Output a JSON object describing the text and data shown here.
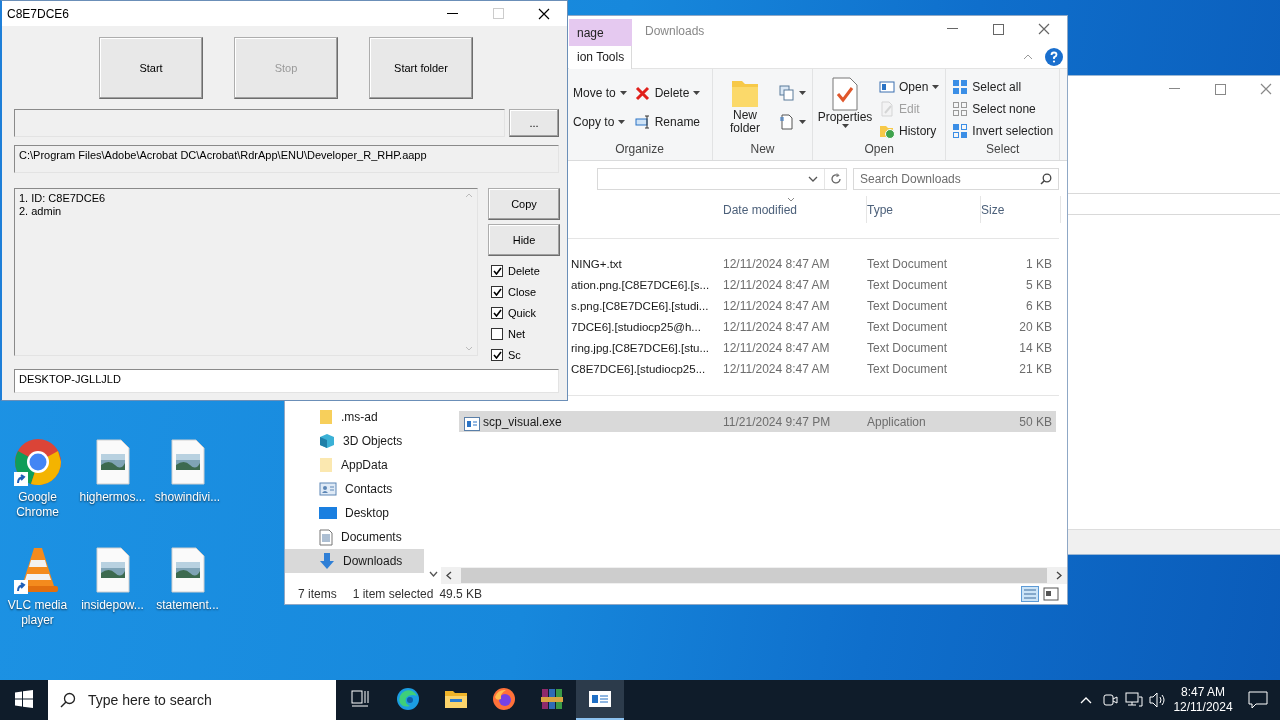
{
  "desktop_icons": [
    {
      "label": "Google Chrome",
      "kind": "chrome"
    },
    {
      "label": "highermos...",
      "kind": "image"
    },
    {
      "label": "showindivi...",
      "kind": "image"
    },
    {
      "label": "VLC media player",
      "kind": "vlc"
    },
    {
      "label": "insidepow...",
      "kind": "image"
    },
    {
      "label": "statement...",
      "kind": "image"
    }
  ],
  "explorer": {
    "context_tab": "nage",
    "context_subtab": "ion Tools",
    "title": "Downloads",
    "ribbon_groups": [
      {
        "label": "Organize",
        "columns": [
          [
            {
              "label": "Move to",
              "kind": "move",
              "dropdown": true,
              "disabled": false
            },
            {
              "label": "Copy to",
              "kind": "copy",
              "dropdown": true,
              "disabled": false
            }
          ],
          [
            {
              "label": "Delete",
              "kind": "delete",
              "dropdown": true,
              "disabled": false
            },
            {
              "label": "Rename",
              "kind": "rename",
              "dropdown": false,
              "disabled": false
            }
          ]
        ]
      },
      {
        "label": "New",
        "columns": [
          [
            {
              "label": "New folder",
              "kind": "new-folder",
              "dropdown": false,
              "disabled": false
            }
          ],
          [
            {
              "kind": "new-item",
              "dropdown": true,
              "disabled": false
            },
            {
              "kind": "easy-access",
              "dropdown": true,
              "disabled": false
            }
          ]
        ]
      },
      {
        "label": "Open",
        "columns": [
          [
            {
              "label": "Properties",
              "kind": "properties",
              "dropdown": true,
              "disabled": false
            }
          ],
          [
            {
              "label": "Open",
              "kind": "open",
              "dropdown": true,
              "disabled": false
            },
            {
              "label": "Edit",
              "kind": "edit",
              "dropdown": false,
              "disabled": true
            },
            {
              "label": "History",
              "kind": "history",
              "dropdown": false,
              "disabled": false
            }
          ]
        ]
      },
      {
        "label": "Select",
        "columns": [
          [
            {
              "label": "Select all",
              "kind": "select-all",
              "dropdown": false,
              "disabled": false
            },
            {
              "label": "Select none",
              "kind": "select-none",
              "dropdown": false,
              "disabled": false
            },
            {
              "label": "Invert selection",
              "kind": "invert",
              "dropdown": false,
              "disabled": false
            }
          ]
        ]
      }
    ],
    "search": {
      "placeholder": "Search Downloads"
    },
    "columns": [
      "Date modified",
      "Type",
      "Size"
    ],
    "today_rows": [
      {
        "name": "NING+.txt",
        "date": "12/11/2024 8:47 AM",
        "type": "Text Document",
        "size": "1 KB",
        "selected": false
      },
      {
        "name": "ation.png.[C8E7DCE6].[s...",
        "date": "12/11/2024 8:47 AM",
        "type": "Text Document",
        "size": "5 KB",
        "selected": false
      },
      {
        "name": "s.png.[C8E7DCE6].[studi...",
        "date": "12/11/2024 8:47 AM",
        "type": "Text Document",
        "size": "6 KB",
        "selected": false
      },
      {
        "name": "7DCE6].[studiocp25@h...",
        "date": "12/11/2024 8:47 AM",
        "type": "Text Document",
        "size": "20 KB",
        "selected": false
      },
      {
        "name": "ring.jpg.[C8E7DCE6].[stu...",
        "date": "12/11/2024 8:47 AM",
        "type": "Text Document",
        "size": "14 KB",
        "selected": false
      },
      {
        "name": "C8E7DCE6].[studiocp25...",
        "date": "12/11/2024 8:47 AM",
        "type": "Text Document",
        "size": "21 KB",
        "selected": false
      }
    ],
    "last_month_rows": [
      {
        "name": "scp_visual.exe",
        "date": "11/21/2024 9:47 PM",
        "type": "Application",
        "size": "50 KB",
        "selected": true
      }
    ],
    "nav": [
      {
        "label": ".ms-ad",
        "kind": "folder",
        "selected": false
      },
      {
        "label": "3D Objects",
        "kind": "cube",
        "selected": false
      },
      {
        "label": "AppData",
        "kind": "folder-light",
        "selected": false
      },
      {
        "label": "Contacts",
        "kind": "contacts",
        "selected": false
      },
      {
        "label": "Desktop",
        "kind": "desktop",
        "selected": false
      },
      {
        "label": "Documents",
        "kind": "documents",
        "selected": false
      },
      {
        "label": "Downloads",
        "kind": "downloads",
        "selected": true
      }
    ],
    "status": {
      "count": "7 items",
      "selection": "1 item selected",
      "size": "49.5 KB"
    }
  },
  "app_window": {
    "title": "C8E7DCE6",
    "buttons": [
      {
        "label": "Start",
        "disabled": false
      },
      {
        "label": "Stop",
        "disabled": true
      },
      {
        "label": "Start folder",
        "disabled": false
      }
    ],
    "browse_button": "...",
    "path": "C:\\Program Files\\Adobe\\Acrobat DC\\Acrobat\\RdrApp\\ENU\\Developer_R_RHP.aapp",
    "log_lines": [
      "1. ID: C8E7DCE6",
      "2. admin"
    ],
    "side_buttons": [
      "Copy",
      "Hide"
    ],
    "options": [
      {
        "label": "Delete",
        "checked": true
      },
      {
        "label": "Close",
        "checked": true
      },
      {
        "label": "Quick",
        "checked": true
      },
      {
        "label": "Net",
        "checked": false
      },
      {
        "label": "Sc",
        "checked": true
      }
    ],
    "computer_name": "DESKTOP-JGLLJLD"
  },
  "taskbar": {
    "search_placeholder": "Type here to search",
    "apps": [
      {
        "kind": "task-view",
        "selected": false
      },
      {
        "kind": "edge",
        "selected": false
      },
      {
        "kind": "explorer",
        "selected": false
      },
      {
        "kind": "firefox",
        "selected": false
      },
      {
        "kind": "winrar",
        "selected": false
      },
      {
        "kind": "app-window",
        "selected": true
      }
    ],
    "tray": [
      {
        "kind": "chevron"
      },
      {
        "kind": "meet"
      },
      {
        "kind": "network"
      },
      {
        "kind": "speaker"
      }
    ],
    "time": "8:47 AM",
    "date": "12/11/2024"
  }
}
